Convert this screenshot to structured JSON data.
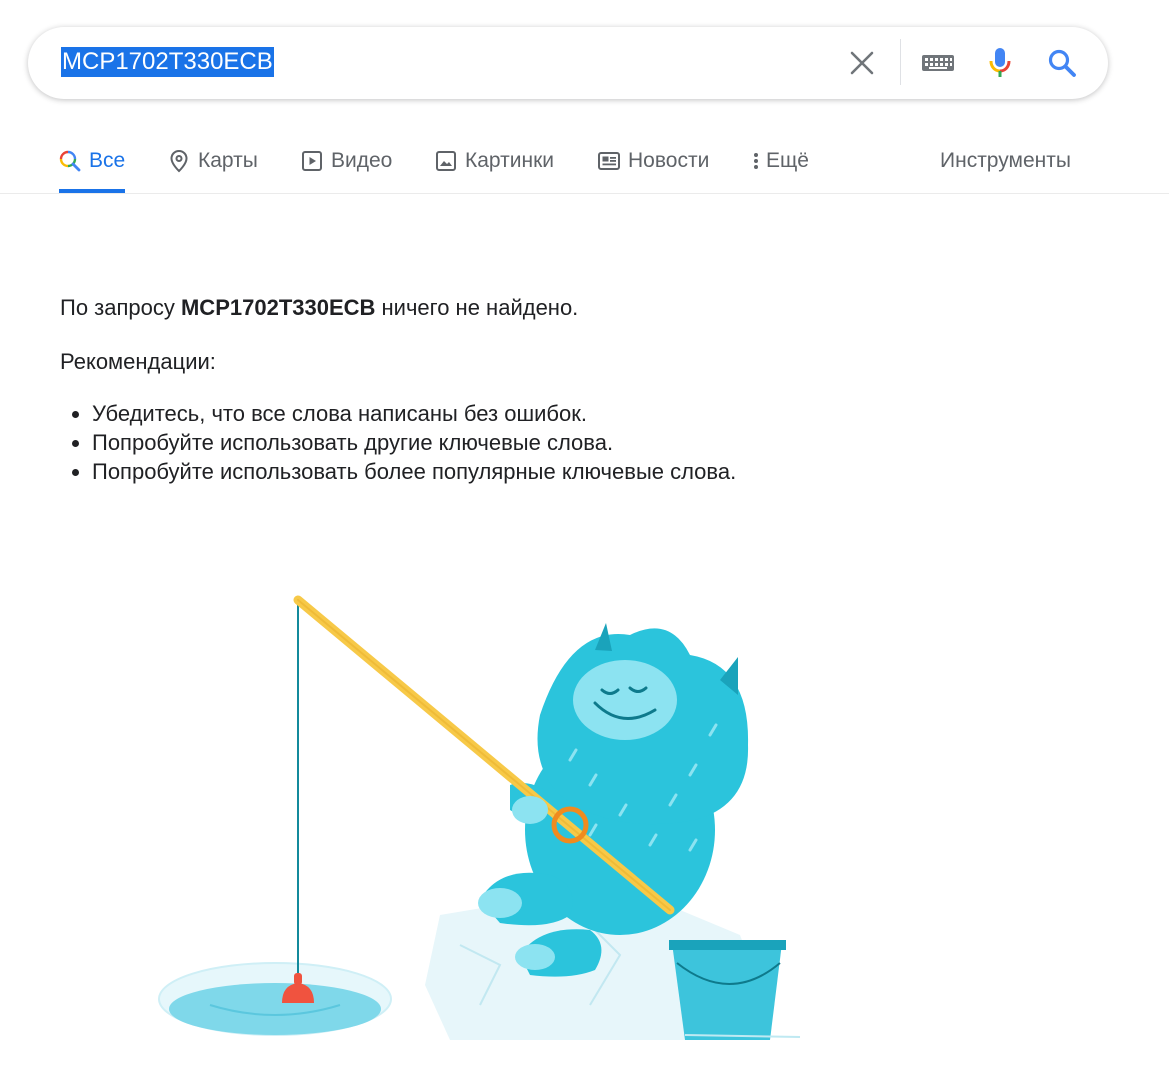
{
  "search": {
    "query": "MCP1702T330ECB"
  },
  "tabs": [
    {
      "label": "Все",
      "active": true
    },
    {
      "label": "Карты"
    },
    {
      "label": "Видео"
    },
    {
      "label": "Картинки"
    },
    {
      "label": "Новости"
    },
    {
      "label": "Ещё"
    },
    {
      "label": "Инструменты"
    }
  ],
  "message": {
    "prefix": "По запросу ",
    "query": "MCP1702T330ECB",
    "suffix": " ничего не найдено.",
    "recommendations_title": "Рекомендации:",
    "recommendations": [
      "Убедитесь, что все слова написаны без ошибок.",
      "Попробуйте использовать другие ключевые слова.",
      "Попробуйте использовать более популярные ключевые слова."
    ]
  },
  "colors": {
    "accent": "#1a73e8",
    "tab_text": "#5f6368",
    "creature": "#2bc4dc"
  },
  "icons": {
    "clear": "close-icon",
    "keyboard": "keyboard-icon",
    "mic": "microphone-icon",
    "search": "search-icon"
  }
}
